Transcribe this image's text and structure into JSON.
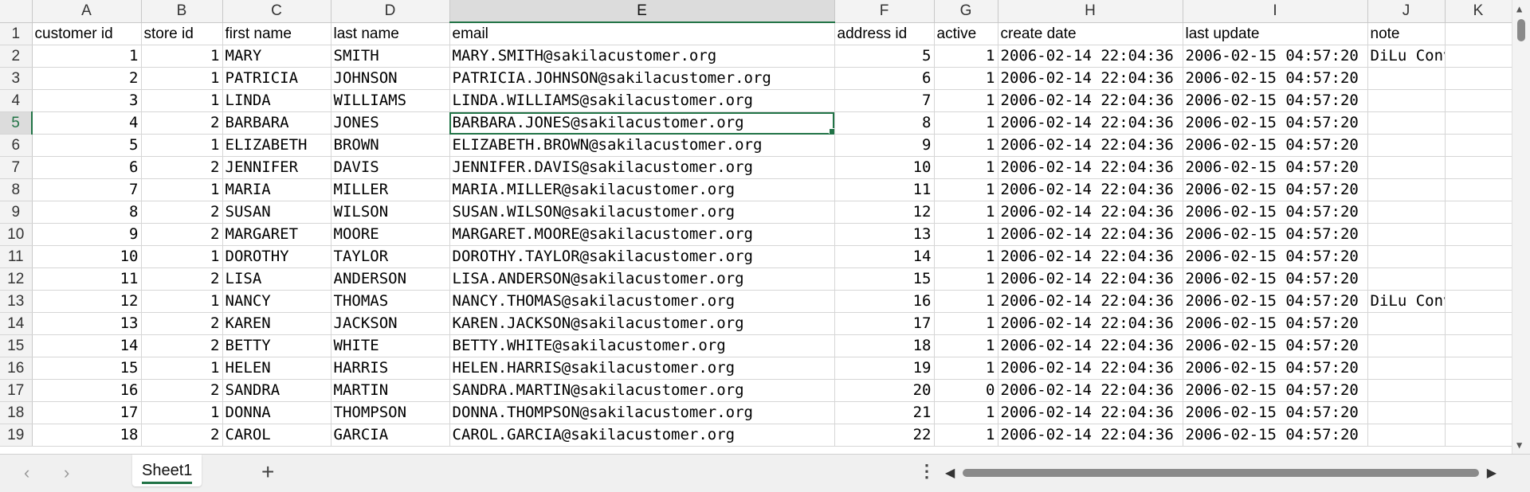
{
  "spreadsheet": {
    "column_letters": [
      "A",
      "B",
      "C",
      "D",
      "E",
      "F",
      "G",
      "H",
      "I",
      "J",
      "K"
    ],
    "selected_column": "E",
    "selected_row": 5,
    "active_cell": "E5",
    "header_row": [
      "customer id",
      "store id",
      "first name",
      "last name",
      "email",
      "address id",
      "active",
      "create date",
      "last update",
      "note",
      ""
    ],
    "rows": [
      [
        "1",
        "1",
        "MARY",
        "SMITH",
        "MARY.SMITH@sakilacustomer.org",
        "5",
        "1",
        "2006-02-14 22:04:36",
        "2006-02-15 04:57:20",
        "DiLu Converter i",
        ""
      ],
      [
        "2",
        "1",
        "PATRICIA",
        "JOHNSON",
        "PATRICIA.JOHNSON@sakilacustomer.org",
        "6",
        "1",
        "2006-02-14 22:04:36",
        "2006-02-15 04:57:20",
        "",
        ""
      ],
      [
        "3",
        "1",
        "LINDA",
        "WILLIAMS",
        "LINDA.WILLIAMS@sakilacustomer.org",
        "7",
        "1",
        "2006-02-14 22:04:36",
        "2006-02-15 04:57:20",
        "",
        ""
      ],
      [
        "4",
        "2",
        "BARBARA",
        "JONES",
        "BARBARA.JONES@sakilacustomer.org",
        "8",
        "1",
        "2006-02-14 22:04:36",
        "2006-02-15 04:57:20",
        "",
        ""
      ],
      [
        "5",
        "1",
        "ELIZABETH",
        "BROWN",
        "ELIZABETH.BROWN@sakilacustomer.org",
        "9",
        "1",
        "2006-02-14 22:04:36",
        "2006-02-15 04:57:20",
        "",
        ""
      ],
      [
        "6",
        "2",
        "JENNIFER",
        "DAVIS",
        "JENNIFER.DAVIS@sakilacustomer.org",
        "10",
        "1",
        "2006-02-14 22:04:36",
        "2006-02-15 04:57:20",
        "",
        ""
      ],
      [
        "7",
        "1",
        "MARIA",
        "MILLER",
        "MARIA.MILLER@sakilacustomer.org",
        "11",
        "1",
        "2006-02-14 22:04:36",
        "2006-02-15 04:57:20",
        "",
        ""
      ],
      [
        "8",
        "2",
        "SUSAN",
        "WILSON",
        "SUSAN.WILSON@sakilacustomer.org",
        "12",
        "1",
        "2006-02-14 22:04:36",
        "2006-02-15 04:57:20",
        "",
        ""
      ],
      [
        "9",
        "2",
        "MARGARET",
        "MOORE",
        "MARGARET.MOORE@sakilacustomer.org",
        "13",
        "1",
        "2006-02-14 22:04:36",
        "2006-02-15 04:57:20",
        "",
        ""
      ],
      [
        "10",
        "1",
        "DOROTHY",
        "TAYLOR",
        "DOROTHY.TAYLOR@sakilacustomer.org",
        "14",
        "1",
        "2006-02-14 22:04:36",
        "2006-02-15 04:57:20",
        "",
        ""
      ],
      [
        "11",
        "2",
        "LISA",
        "ANDERSON",
        "LISA.ANDERSON@sakilacustomer.org",
        "15",
        "1",
        "2006-02-14 22:04:36",
        "2006-02-15 04:57:20",
        "",
        ""
      ],
      [
        "12",
        "1",
        "NANCY",
        "THOMAS",
        "NANCY.THOMAS@sakilacustomer.org",
        "16",
        "1",
        "2006-02-14 22:04:36",
        "2006-02-15 04:57:20",
        "DiLu Converter i",
        ""
      ],
      [
        "13",
        "2",
        "KAREN",
        "JACKSON",
        "KAREN.JACKSON@sakilacustomer.org",
        "17",
        "1",
        "2006-02-14 22:04:36",
        "2006-02-15 04:57:20",
        "",
        ""
      ],
      [
        "14",
        "2",
        "BETTY",
        "WHITE",
        "BETTY.WHITE@sakilacustomer.org",
        "18",
        "1",
        "2006-02-14 22:04:36",
        "2006-02-15 04:57:20",
        "",
        ""
      ],
      [
        "15",
        "1",
        "HELEN",
        "HARRIS",
        "HELEN.HARRIS@sakilacustomer.org",
        "19",
        "1",
        "2006-02-14 22:04:36",
        "2006-02-15 04:57:20",
        "",
        ""
      ],
      [
        "16",
        "2",
        "SANDRA",
        "MARTIN",
        "SANDRA.MARTIN@sakilacustomer.org",
        "20",
        "0",
        "2006-02-14 22:04:36",
        "2006-02-15 04:57:20",
        "",
        ""
      ],
      [
        "17",
        "1",
        "DONNA",
        "THOMPSON",
        "DONNA.THOMPSON@sakilacustomer.org",
        "21",
        "1",
        "2006-02-14 22:04:36",
        "2006-02-15 04:57:20",
        "",
        ""
      ],
      [
        "18",
        "2",
        "CAROL",
        "GARCIA",
        "CAROL.GARCIA@sakilacustomer.org",
        "22",
        "1",
        "2006-02-14 22:04:36",
        "2006-02-15 04:57:20",
        "",
        ""
      ]
    ],
    "numeric_columns": [
      0,
      1,
      5,
      6
    ]
  },
  "bottom_bar": {
    "sheet_tab_label": "Sheet1",
    "prev_sheet_icon": "chevron-left-icon",
    "next_sheet_icon": "chevron-right-icon",
    "add_sheet_icon": "plus-icon",
    "more_icon": "vertical-ellipsis-icon"
  },
  "colors": {
    "accent": "#217346",
    "header_bg": "#f3f3f3",
    "gridline": "#d6d6d6"
  }
}
